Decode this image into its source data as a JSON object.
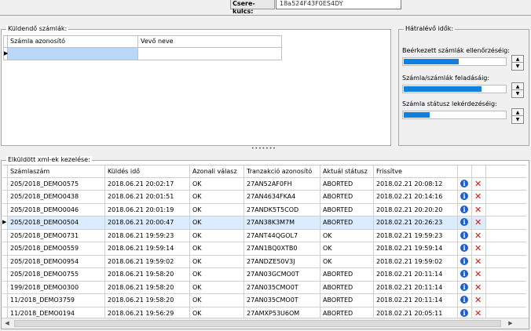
{
  "header": {
    "key_label": "Csere-kulcs:",
    "key_value": "18a524F43F0ES4DY"
  },
  "pending": {
    "title": "Küldendő számlák:",
    "columns": [
      "Számla azonosító",
      "Vevő neve"
    ],
    "row_marker": "▶"
  },
  "progress": {
    "title": "Hátralévő idők:",
    "items": [
      {
        "label": "Beérkezett számlák ellenőrzéséig:",
        "value": 0.55
      },
      {
        "label": "Számla/számlák feladásáig:",
        "value": 0.77
      },
      {
        "label": "Számla státusz lekérdezéséig:",
        "value": 0.27
      }
    ],
    "bar_color": "#0e80e0"
  },
  "splitter": "•••••••",
  "sent": {
    "title": "Elküldött xml-ek kezelése:",
    "columns": [
      "Számlaszám",
      "Küldés idő",
      "Azonali válasz",
      "Tranzakció azonosító",
      "Aktuál státusz",
      "Frissítve",
      "",
      ""
    ],
    "rows": [
      {
        "marker": "",
        "szamla": "205/2018_DEMO0575",
        "kuldes": "2018.06.21 20:02:17",
        "valasz": "OK",
        "tranz": "27AN52AF0FH",
        "statusz": "ABORTED",
        "frissitve": "2018.02.21 20:08:12"
      },
      {
        "marker": "",
        "szamla": "205/2018_DEMO0438",
        "kuldes": "2018.06.21 20:01:51",
        "valasz": "OK",
        "tranz": "27AN4634FKA4",
        "statusz": "ABORTED",
        "frissitve": "2018.02.21 20:14:16"
      },
      {
        "marker": "",
        "szamla": "205/2018_DEMO0046",
        "kuldes": "2018.06.21 20:01:19",
        "valasz": "OK",
        "tranz": "27ANDK5T5COD",
        "statusz": "ABORTED",
        "frissitve": "2018.02.21 20:20:20"
      },
      {
        "marker": "▶",
        "szamla": "205/2018_DEMO0504",
        "kuldes": "2018.06.21 20:00:47",
        "valasz": "OK",
        "tranz": "27AN38K3M7M",
        "statusz": "ABORTED",
        "frissitve": "2018.02.21 20:26:23"
      },
      {
        "marker": "",
        "szamla": "205/2018_DEMO0731",
        "kuldes": "2018.06.21 19:59:23",
        "valasz": "OK",
        "tranz": "27ANT44QGOL7",
        "statusz": "OK",
        "frissitve": "2018.02.21 19:59:23"
      },
      {
        "marker": "",
        "szamla": "205/2018_DEMO0559",
        "kuldes": "2018.06.21 19:59:14",
        "valasz": "OK",
        "tranz": "27AN1BQ0XTB0",
        "statusz": "OK",
        "frissitve": "2018.02.21 19:59:14"
      },
      {
        "marker": "",
        "szamla": "205/2018_DEMO0954",
        "kuldes": "2018.06.21 19:59:02",
        "valasz": "OK",
        "tranz": "27ANDZE50V3J",
        "statusz": "OK",
        "frissitve": "2018.02.21 19:59:02"
      },
      {
        "marker": "",
        "szamla": "205/2018_DEMO0755",
        "kuldes": "2018.06.21 19:58:20",
        "valasz": "OK",
        "tranz": "27AN03GCMO0T",
        "statusz": "ABORTED",
        "frissitve": "2018.02.21 20:11:14"
      },
      {
        "marker": "",
        "szamla": "199/2018_DEMO0300",
        "kuldes": "2018.06.21 19:58:20",
        "valasz": "OK",
        "tranz": "27AN035CMO0T",
        "statusz": "ABORTED",
        "frissitve": "2018.02.21 20:11:14"
      },
      {
        "marker": "",
        "szamla": "11/2018_DEMO3759",
        "kuldes": "2018.06.21 19:58:20",
        "valasz": "OK",
        "tranz": "27AN035CMO0T",
        "statusz": "ABORTED",
        "frissitve": "2018.02.21 20:11:14"
      },
      {
        "marker": "",
        "szamla": "11/2018_DEMO0194",
        "kuldes": "2018.06.21 19:56:29",
        "valasz": "OK",
        "tranz": "27AMXP53U6OM",
        "statusz": "ABORTED",
        "frissitve": "2018.02.21 20:05:11"
      }
    ],
    "info_glyph": "i",
    "delete_glyph": "✕"
  },
  "scroll": {
    "left_arrow": "◀",
    "right_arrow": "▶"
  },
  "spin": {
    "up": "▲",
    "down": "▼"
  }
}
